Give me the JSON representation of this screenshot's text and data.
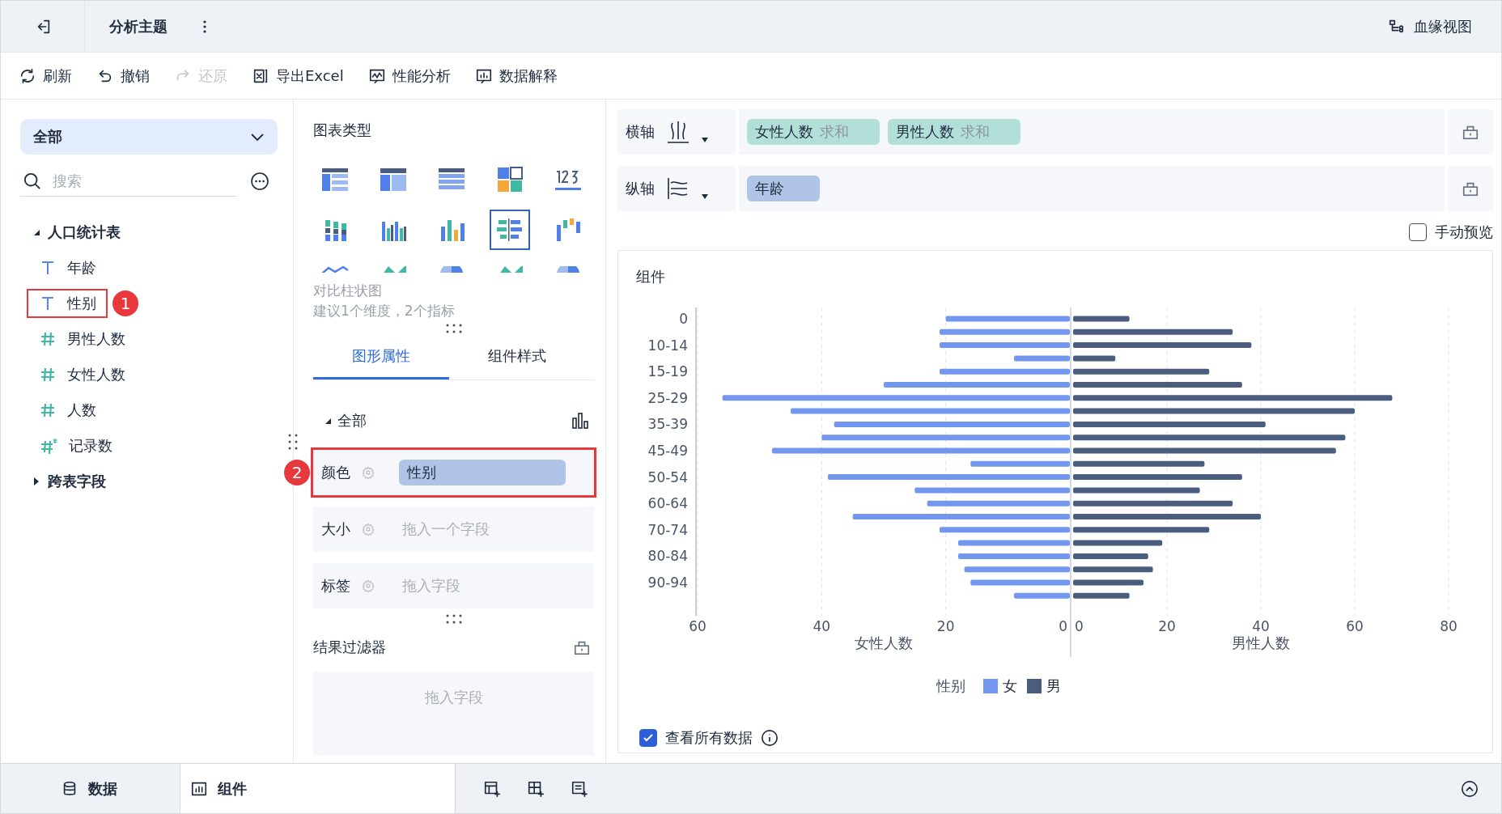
{
  "header": {
    "title": "分析主题",
    "lineage_button": "血缘视图"
  },
  "toolbar": [
    {
      "label": "刷新",
      "kind": "refresh",
      "disabled": false
    },
    {
      "label": "撤销",
      "kind": "undo",
      "disabled": false
    },
    {
      "label": "还原",
      "kind": "redo",
      "disabled": true
    },
    {
      "label": "导出Excel",
      "kind": "excel",
      "disabled": false
    },
    {
      "label": "性能分析",
      "kind": "performance",
      "disabled": false
    },
    {
      "label": "数据解释",
      "kind": "explain",
      "disabled": false
    }
  ],
  "field_panel": {
    "dataset_select": "全部",
    "search_placeholder": "搜索",
    "tree": [
      {
        "label": "人口统计表",
        "expanded": true,
        "children": [
          {
            "label": "年龄",
            "kind": "text"
          },
          {
            "label": "性别",
            "kind": "text",
            "marker": "1"
          },
          {
            "label": "男性人数",
            "kind": "number"
          },
          {
            "label": "女性人数",
            "kind": "number"
          },
          {
            "label": "人数",
            "kind": "number"
          },
          {
            "label": "记录数",
            "kind": "count"
          }
        ]
      },
      {
        "label": "跨表字段",
        "expanded": false
      }
    ]
  },
  "chart_types": {
    "title": "图表类型",
    "items": [
      {
        "kind": "table",
        "selected": false
      },
      {
        "kind": "cross-table",
        "selected": false
      },
      {
        "kind": "detail-table",
        "selected": false
      },
      {
        "kind": "card",
        "selected": false
      },
      {
        "kind": "kpi",
        "selected": false
      },
      {
        "kind": "stacked-bar",
        "selected": false
      },
      {
        "kind": "grouped-bar",
        "selected": false
      },
      {
        "kind": "bar",
        "selected": false
      },
      {
        "kind": "compare-bar",
        "selected": true
      },
      {
        "kind": "waterfall",
        "selected": false
      },
      {
        "kind": "line",
        "selected": false
      },
      {
        "kind": "area",
        "selected": false
      },
      {
        "kind": "pie",
        "selected": false
      },
      {
        "kind": "area",
        "selected": false
      },
      {
        "kind": "pie",
        "selected": false
      }
    ],
    "description": "对比柱状图",
    "hint": "建议1个维度，2个指标"
  },
  "property_tabs": [
    {
      "label": "图形属性",
      "selected": true
    },
    {
      "label": "组件样式",
      "selected": false
    }
  ],
  "properties": {
    "group": "全部",
    "expanded": true,
    "rows": [
      {
        "label": "颜色",
        "field": "性别",
        "marker": "2"
      },
      {
        "label": "大小",
        "placeholder": "拖入一个字段"
      },
      {
        "label": "标签",
        "placeholder": "拖入字段"
      }
    ]
  },
  "result_filter": {
    "title": "结果过滤器",
    "placeholder": "拖入字段"
  },
  "axes": [
    {
      "label": "横轴",
      "kind": "horizontal",
      "fields": [
        {
          "name": "女性人数",
          "aggregation": "求和",
          "kind": "measure"
        },
        {
          "name": "男性人数",
          "aggregation": "求和",
          "kind": "measure"
        }
      ]
    },
    {
      "label": "纵轴",
      "kind": "vertical",
      "fields": [
        {
          "name": "年龄",
          "kind": "dimension"
        }
      ]
    }
  ],
  "manual_preview": {
    "label": "手动预览",
    "checked": false
  },
  "chart_panel": {
    "title": "组件",
    "legend_title": "性别",
    "female_side": {
      "chart_data": {
        "type": "bar",
        "orientation": "horizontal",
        "xlabel": "女性人数",
        "categories": [
          "0",
          null,
          "10-14",
          null,
          "15-19",
          null,
          "25-29",
          null,
          "35-39",
          null,
          "45-49",
          null,
          "50-54",
          null,
          "60-64",
          null,
          "70-74",
          null,
          "80-84",
          null,
          "90-94",
          null
        ],
        "series": [
          {
            "name": "女",
            "color": "#7396ef",
            "values": [
              20,
              21,
              21,
              9,
              21,
              30,
              56,
              45,
              38,
              40,
              48,
              16,
              39,
              25,
              23,
              35,
              21,
              18,
              18,
              17,
              16,
              9
            ]
          }
        ],
        "xlim": [
          60,
          0
        ],
        "xticks": [
          60,
          40,
          20,
          0
        ],
        "grid": true
      }
    },
    "male_side": {
      "chart_data": {
        "type": "bar",
        "orientation": "horizontal",
        "xlabel": "男性人数",
        "series": [
          {
            "name": "男",
            "color": "#4a5d7f",
            "values": [
              12,
              34,
              38,
              9,
              29,
              36,
              68,
              60,
              41,
              58,
              56,
              28,
              36,
              27,
              34,
              40,
              29,
              19,
              16,
              17,
              15,
              12
            ]
          }
        ],
        "xlim": [
          0,
          80
        ],
        "xticks": [
          0,
          20,
          40,
          60,
          80
        ],
        "grid": true
      }
    },
    "view_all": {
      "label": "查看所有数据",
      "checked": true
    }
  },
  "bottom_tabs": [
    {
      "label": "数据",
      "kind": "data",
      "selected": false
    },
    {
      "label": "组件",
      "kind": "component",
      "selected": true
    }
  ]
}
